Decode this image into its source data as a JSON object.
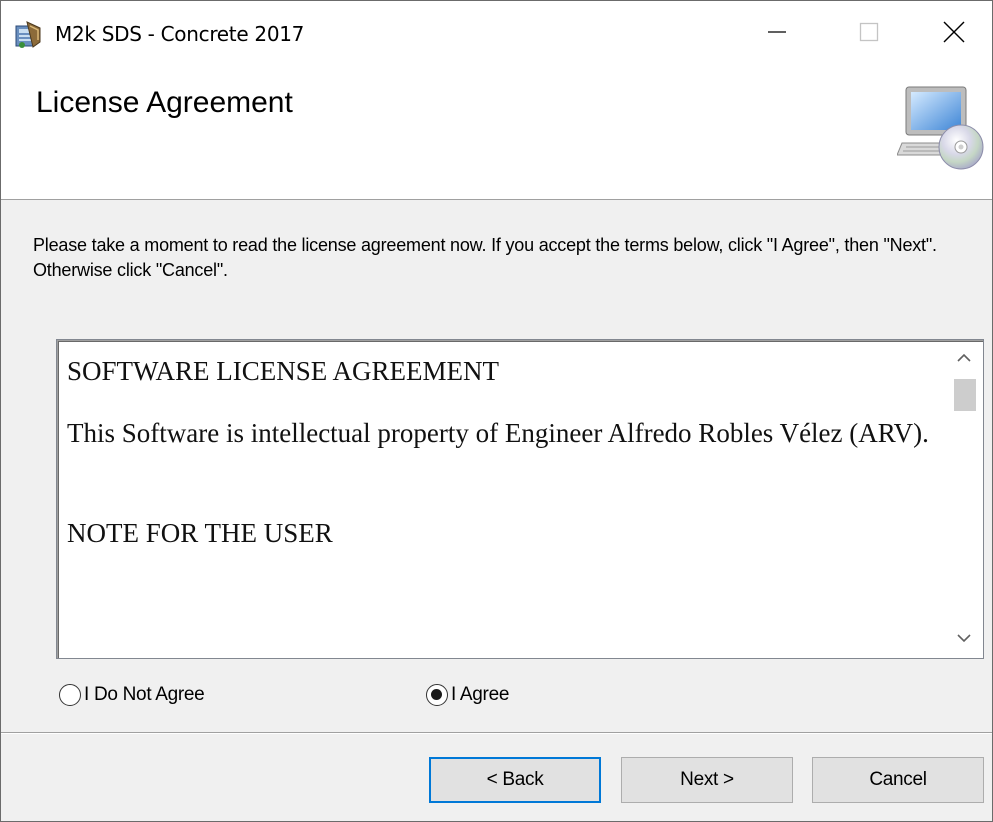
{
  "window": {
    "title": "M2k SDS - Concrete 2017",
    "icons": {
      "app": "installer-app-icon",
      "minimize": "minimize-icon",
      "maximize": "maximize-icon",
      "close": "close-icon"
    }
  },
  "header": {
    "title": "License Agreement",
    "icon": "computer-cd-setup-icon"
  },
  "instruction": "Please take a moment to read the license agreement now. If you accept the terms below, click \"I Agree\", then \"Next\". Otherwise click \"Cancel\".",
  "license": {
    "heading": "SOFTWARE LICENSE AGREEMENT",
    "paragraph1": "This Software is intellectual property of Engineer Alfredo Robles Vélez (ARV).",
    "heading2": "NOTE FOR THE USER"
  },
  "radios": {
    "not_agree": {
      "label": "I Do Not Agree",
      "selected": false
    },
    "agree": {
      "label": "I Agree",
      "selected": true
    }
  },
  "buttons": {
    "back": "< Back",
    "next": "Next >",
    "cancel": "Cancel"
  },
  "colors": {
    "focus_border": "#0078d7",
    "button_face": "#e1e1e1",
    "dialog_bg": "#f0f0f0"
  }
}
